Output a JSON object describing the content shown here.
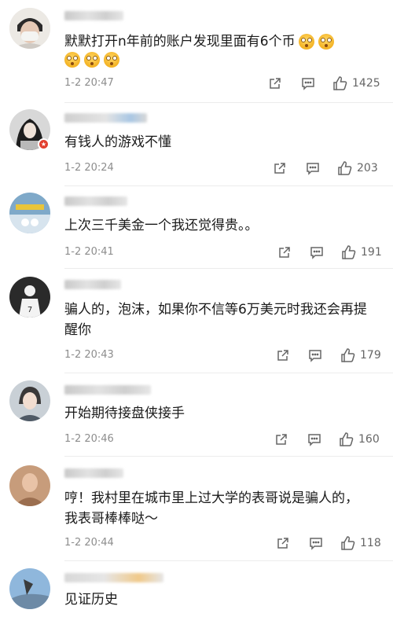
{
  "comments": [
    {
      "text": "默默打开n年前的账户发现里面有6个币",
      "time": "1-2 20:47",
      "likes": "1425"
    },
    {
      "text": "有钱人的游戏不懂",
      "time": "1-2 20:24",
      "likes": "203"
    },
    {
      "text": "上次三千美金一个我还觉得贵。。",
      "time": "1-2 20:41",
      "likes": "191"
    },
    {
      "text": "骗人的，泡沫，如果你不信等6万美元时我还会再提醒你",
      "time": "1-2 20:43",
      "likes": "179"
    },
    {
      "text": "开始期待接盘侠接手",
      "time": "1-2 20:46",
      "likes": "160"
    },
    {
      "text": "哼！我村里在城市里上过大学的表哥说是骗人的，我表哥棒棒哒～",
      "time": "1-2 20:44",
      "likes": "118"
    },
    {
      "text": "见证历史"
    }
  ],
  "icons": {
    "share": "share-icon",
    "comment": "comment-icon",
    "like": "thumbs-up-icon",
    "emoji": "flushed-face-emoji"
  },
  "colors": {
    "meta": "#8d8d8d",
    "text": "#1a1a1a",
    "badge": "#f5b400"
  }
}
